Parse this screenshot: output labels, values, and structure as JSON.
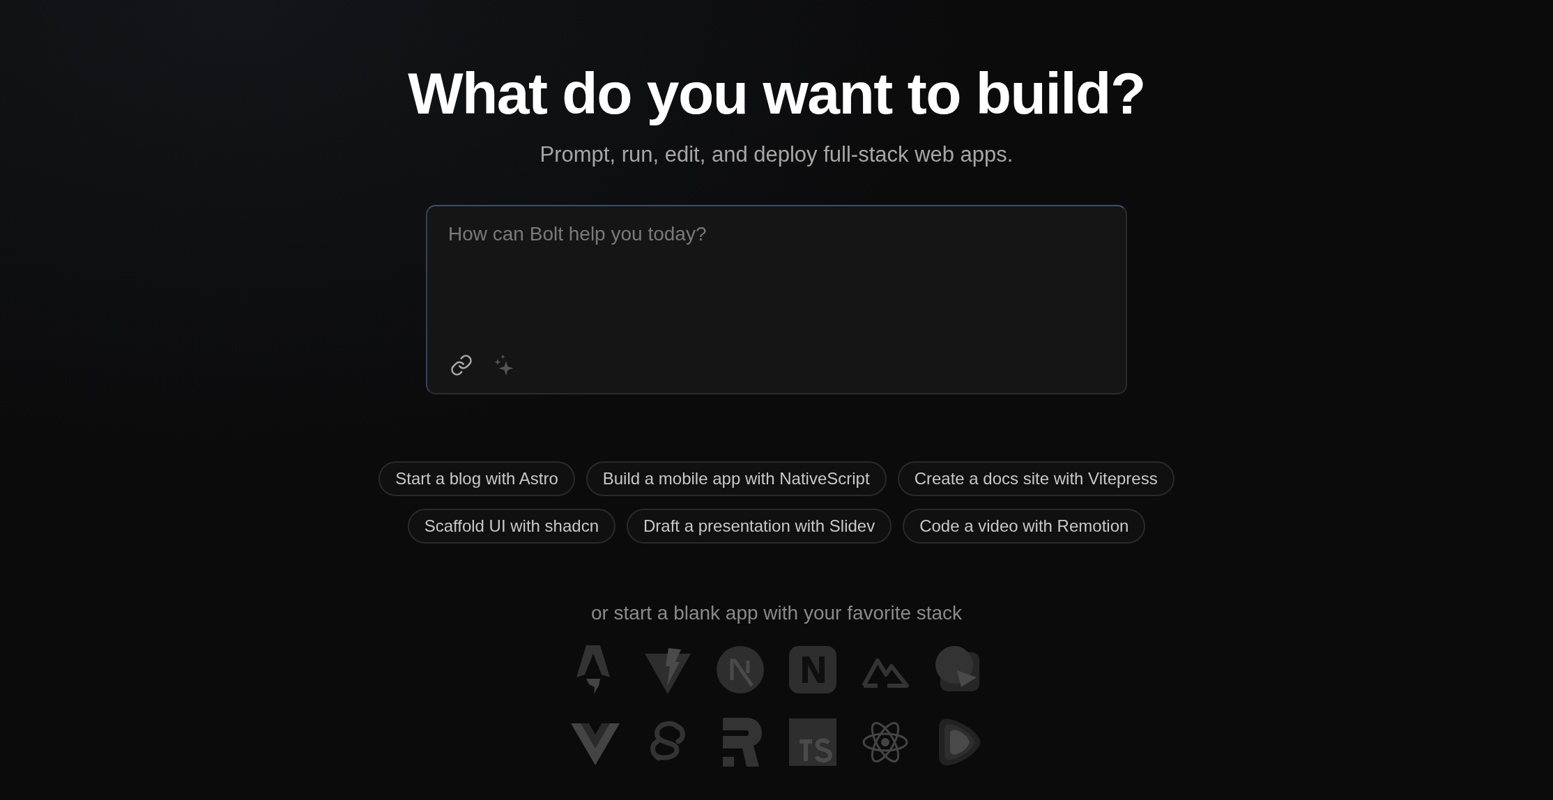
{
  "heading": "What do you want to build?",
  "subheading": "Prompt, run, edit, and deploy full-stack web apps.",
  "prompt": {
    "placeholder": "How can Bolt help you today?"
  },
  "suggestions": [
    [
      "Start a blog with Astro",
      "Build a mobile app with NativeScript",
      "Create a docs site with Vitepress"
    ],
    [
      "Scaffold UI with shadcn",
      "Draft a presentation with Slidev",
      "Code a video with Remotion"
    ]
  ],
  "stack_prompt": "or start a blank app with your favorite stack"
}
